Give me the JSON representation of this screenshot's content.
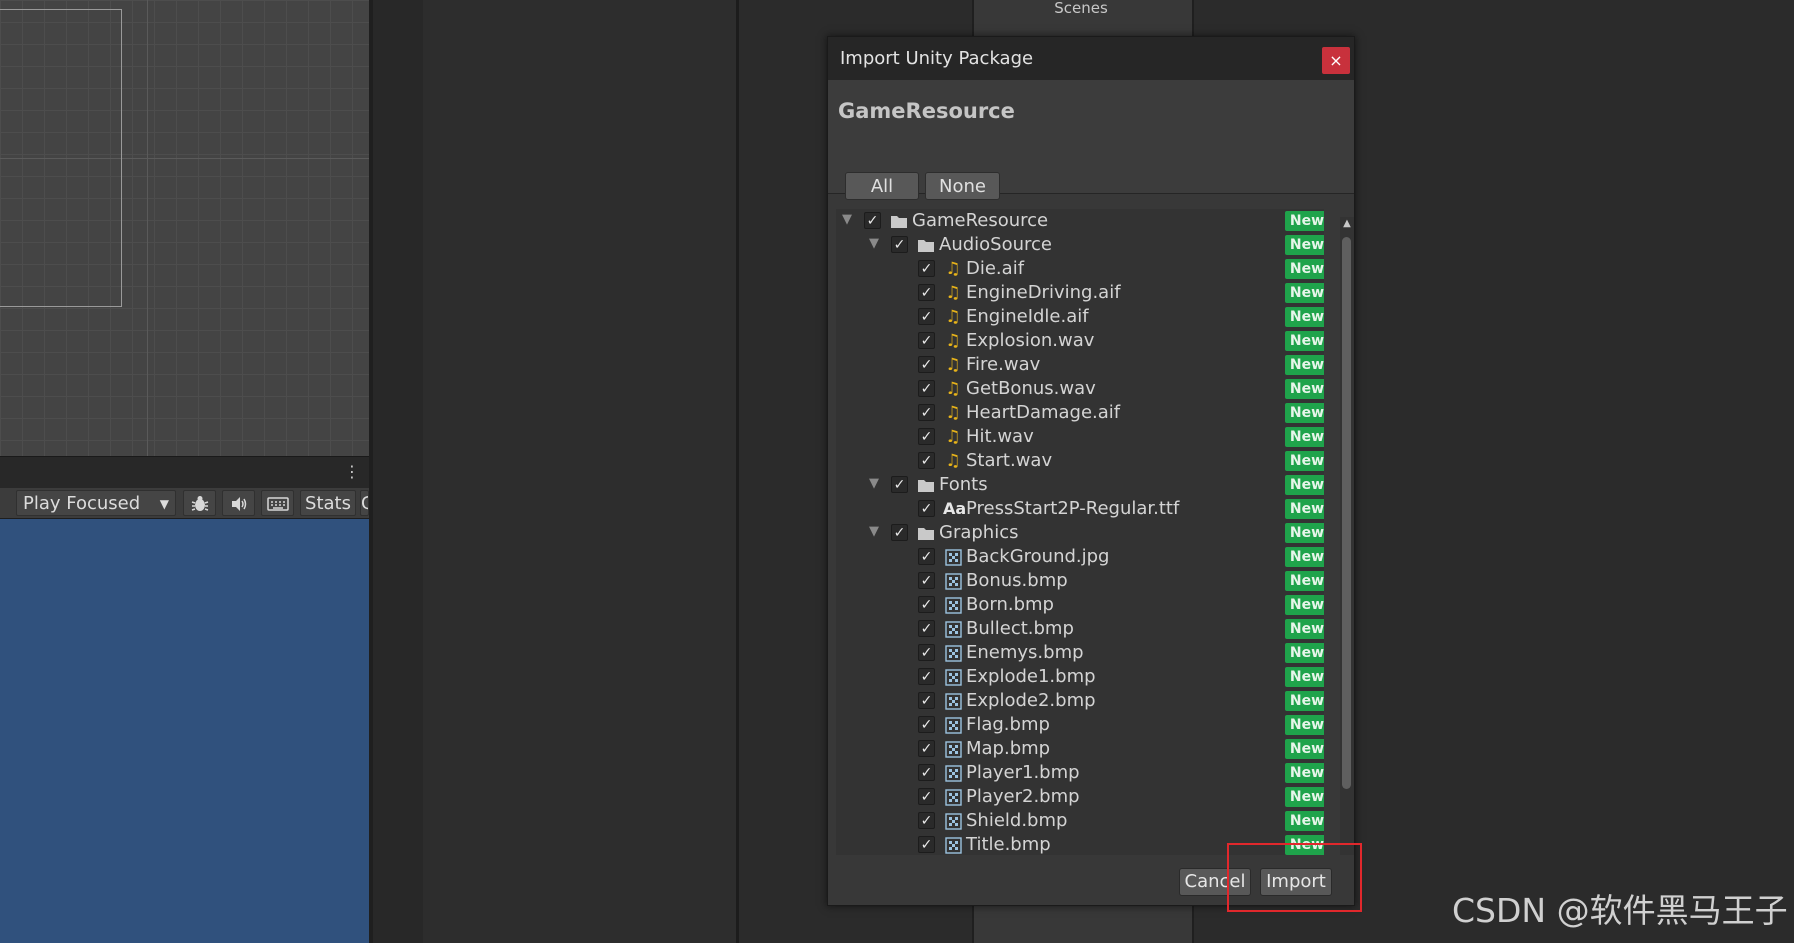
{
  "background": {
    "scenes_tab": "Scenes"
  },
  "game_toolbar": {
    "play_mode": "Play Focused",
    "stats": "Stats",
    "trailing": "G"
  },
  "dialog": {
    "title": "Import Unity Package",
    "close_glyph": "×",
    "package_name": "GameResource",
    "all_button": "All",
    "none_button": "None",
    "cancel_button": "Cancel",
    "import_button": "Import",
    "new_badge": "New",
    "tree": [
      {
        "label": "GameResource",
        "type": "folder",
        "depth": 0,
        "expanded": true,
        "checked": true
      },
      {
        "label": "AudioSource",
        "type": "folder",
        "depth": 1,
        "expanded": true,
        "checked": true
      },
      {
        "label": "Die.aif",
        "type": "audio",
        "depth": 2,
        "checked": true
      },
      {
        "label": "EngineDriving.aif",
        "type": "audio",
        "depth": 2,
        "checked": true
      },
      {
        "label": "EngineIdle.aif",
        "type": "audio",
        "depth": 2,
        "checked": true
      },
      {
        "label": "Explosion.wav",
        "type": "audio",
        "depth": 2,
        "checked": true
      },
      {
        "label": "Fire.wav",
        "type": "audio",
        "depth": 2,
        "checked": true
      },
      {
        "label": "GetBonus.wav",
        "type": "audio",
        "depth": 2,
        "checked": true
      },
      {
        "label": "HeartDamage.aif",
        "type": "audio",
        "depth": 2,
        "checked": true
      },
      {
        "label": "Hit.wav",
        "type": "audio",
        "depth": 2,
        "checked": true
      },
      {
        "label": "Start.wav",
        "type": "audio",
        "depth": 2,
        "checked": true
      },
      {
        "label": "Fonts",
        "type": "folder",
        "depth": 1,
        "expanded": true,
        "checked": true
      },
      {
        "label": "PressStart2P-Regular.ttf",
        "type": "font",
        "depth": 2,
        "checked": true
      },
      {
        "label": "Graphics",
        "type": "folder",
        "depth": 1,
        "expanded": true,
        "checked": true
      },
      {
        "label": "BackGround.jpg",
        "type": "image",
        "depth": 2,
        "checked": true
      },
      {
        "label": "Bonus.bmp",
        "type": "image",
        "depth": 2,
        "checked": true
      },
      {
        "label": "Born.bmp",
        "type": "image",
        "depth": 2,
        "checked": true
      },
      {
        "label": "Bullect.bmp",
        "type": "image",
        "depth": 2,
        "checked": true
      },
      {
        "label": "Enemys.bmp",
        "type": "image",
        "depth": 2,
        "checked": true
      },
      {
        "label": "Explode1.bmp",
        "type": "image",
        "depth": 2,
        "checked": true
      },
      {
        "label": "Explode2.bmp",
        "type": "image",
        "depth": 2,
        "checked": true
      },
      {
        "label": "Flag.bmp",
        "type": "image",
        "depth": 2,
        "checked": true
      },
      {
        "label": "Map.bmp",
        "type": "image",
        "depth": 2,
        "checked": true
      },
      {
        "label": "Player1.bmp",
        "type": "image",
        "depth": 2,
        "checked": true
      },
      {
        "label": "Player2.bmp",
        "type": "image",
        "depth": 2,
        "checked": true
      },
      {
        "label": "Shield.bmp",
        "type": "image",
        "depth": 2,
        "checked": true
      },
      {
        "label": "Title.bmp",
        "type": "image",
        "depth": 2,
        "checked": true
      }
    ]
  },
  "watermark": "CSDN @软件黑马王子",
  "colors": {
    "new_badge": "#1fa34b",
    "close_button": "#c8313c",
    "highlight_box": "#e1282c",
    "game_view": "#30517d",
    "audio_icon": "#e7b31a"
  },
  "icons": {
    "folder": "folder-icon",
    "audio": "audio-file-icon",
    "font": "font-file-icon",
    "image": "image-file-icon"
  }
}
